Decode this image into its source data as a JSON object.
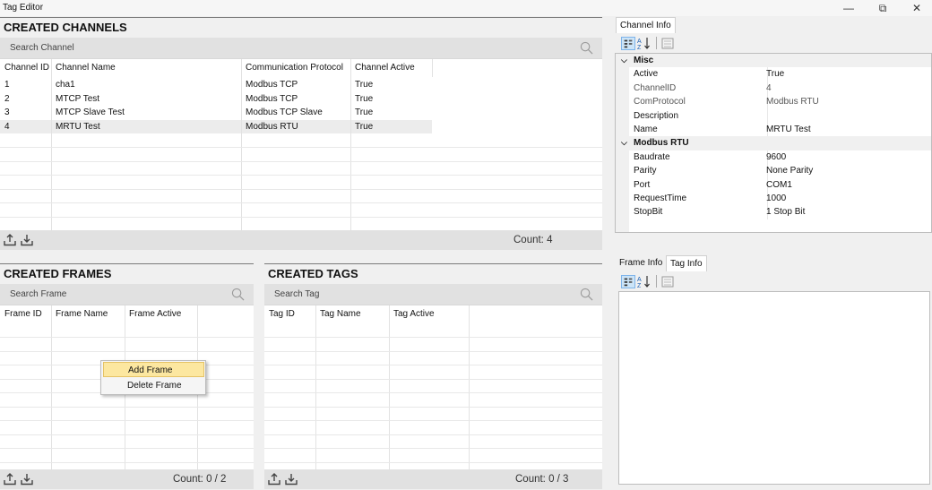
{
  "window": {
    "title": "Tag Editor",
    "controls": [
      "—",
      "⧉",
      "✕"
    ]
  },
  "channels": {
    "title": "CREATED CHANNELS",
    "search_placeholder": "Search Channel",
    "columns": [
      "Channel ID",
      "Channel Name",
      "Communication Protocol",
      "Channel Active"
    ],
    "rows": [
      [
        "1",
        "cha1",
        "Modbus TCP",
        "True"
      ],
      [
        "2",
        "MTCP Test",
        "Modbus TCP",
        "True"
      ],
      [
        "3",
        "MTCP Slave Test",
        "Modbus TCP Slave",
        "True"
      ],
      [
        "4",
        "MRTU Test",
        "Modbus RTU",
        "True"
      ]
    ],
    "selected_row": 3,
    "count": "Count: 4"
  },
  "frames": {
    "title": "CREATED FRAMES",
    "search_placeholder": "Search Frame",
    "columns": [
      "Frame ID",
      "Frame Name",
      "Frame Active"
    ],
    "count": "Count: 0 / 2"
  },
  "tags": {
    "title": "CREATED TAGS",
    "search_placeholder": "Search Tag",
    "columns": [
      "Tag ID",
      "Tag Name",
      "Tag Active"
    ],
    "count": "Count: 0 / 3"
  },
  "context_menu": {
    "items": [
      "Add Frame",
      "Delete Frame"
    ],
    "highlighted": 0
  },
  "channel_info": {
    "tab": "Channel Info",
    "categories": [
      {
        "name": "Misc",
        "props": [
          {
            "name": "Active",
            "value": "True",
            "readonly": false
          },
          {
            "name": "ChannelID",
            "value": "4",
            "readonly": true
          },
          {
            "name": "ComProtocol",
            "value": "Modbus RTU",
            "readonly": true
          },
          {
            "name": "Description",
            "value": "",
            "readonly": false
          },
          {
            "name": "Name",
            "value": "MRTU Test",
            "readonly": false
          }
        ]
      },
      {
        "name": "Modbus RTU",
        "props": [
          {
            "name": "Baudrate",
            "value": "9600",
            "readonly": false
          },
          {
            "name": "Parity",
            "value": "None Parity",
            "readonly": false
          },
          {
            "name": "Port",
            "value": "COM1",
            "readonly": false
          },
          {
            "name": "RequestTime",
            "value": "1000",
            "readonly": false
          },
          {
            "name": "StopBit",
            "value": "1 Stop Bit",
            "readonly": false
          }
        ]
      }
    ]
  },
  "lower_info": {
    "tabs": [
      "Frame Info",
      "Tag Info"
    ],
    "active_tab": 1
  },
  "icons": {
    "categorized": "categorized-view-icon",
    "alphabetical": "alphabetical-sort-icon",
    "property_pages": "property-pages-icon",
    "search": "search-icon",
    "upload": "upload-icon",
    "download": "download-icon"
  },
  "colors": {
    "selected_row": "#ececec",
    "menu_highlight": "#fce7a0",
    "toolbar_active": "#cce4f7"
  }
}
